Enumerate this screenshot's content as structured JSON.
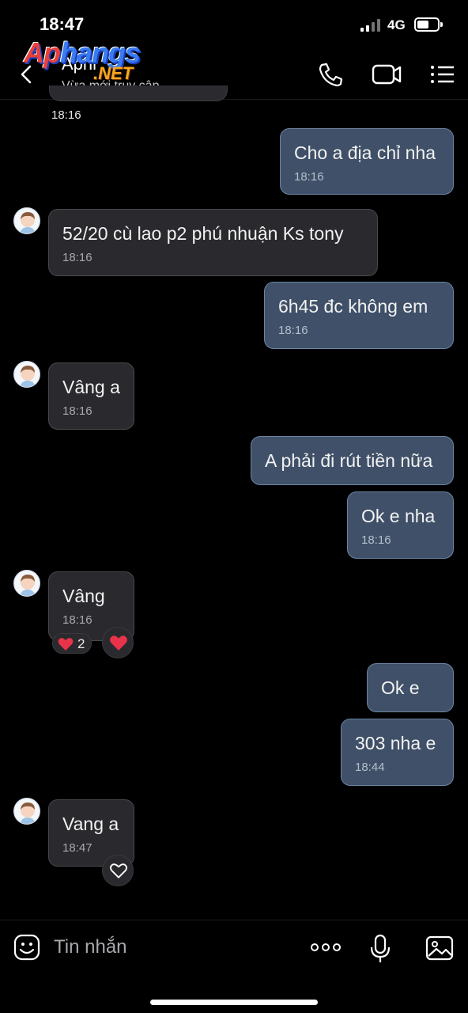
{
  "status_bar": {
    "time": "18:47",
    "network": "4G",
    "battery_percent": 45
  },
  "header": {
    "contact_name": "April",
    "presence": "Vừa mới truy cập"
  },
  "watermark": {
    "line1_red": "Ap",
    "line1_blue": "hangs",
    "line2": ".NET"
  },
  "messages": {
    "first_time": "18:16",
    "m1": {
      "text": "Cho a địa chỉ nha",
      "time": "18:16"
    },
    "m2": {
      "text": "52/20 cù lao p2 phú nhuận Ks tony",
      "time": "18:16"
    },
    "m3": {
      "text": "6h45 đc không em",
      "time": "18:16"
    },
    "m4": {
      "text": "Vâng a",
      "time": "18:16"
    },
    "m5": {
      "text": "A phải đi rút tiền nữa"
    },
    "m6": {
      "text": "Ok e nha",
      "time": "18:16"
    },
    "m7": {
      "text": "Vâng",
      "time": "18:16",
      "reaction_count": "2"
    },
    "m8": {
      "text": "Ok e"
    },
    "m9": {
      "text": "303 nha e",
      "time": "18:44"
    },
    "m10": {
      "text": "Vang a",
      "time": "18:47"
    }
  },
  "composer": {
    "placeholder": "Tin nhắn"
  },
  "colors": {
    "outgoing_bubble": "#3f5068",
    "incoming_bubble": "#2a2a2e",
    "heart": "#e8334a"
  },
  "icons": [
    "back-icon",
    "phone-icon",
    "video-icon",
    "menu-icon",
    "emoji-icon",
    "more-icon",
    "mic-icon",
    "image-icon",
    "heart-icon"
  ]
}
